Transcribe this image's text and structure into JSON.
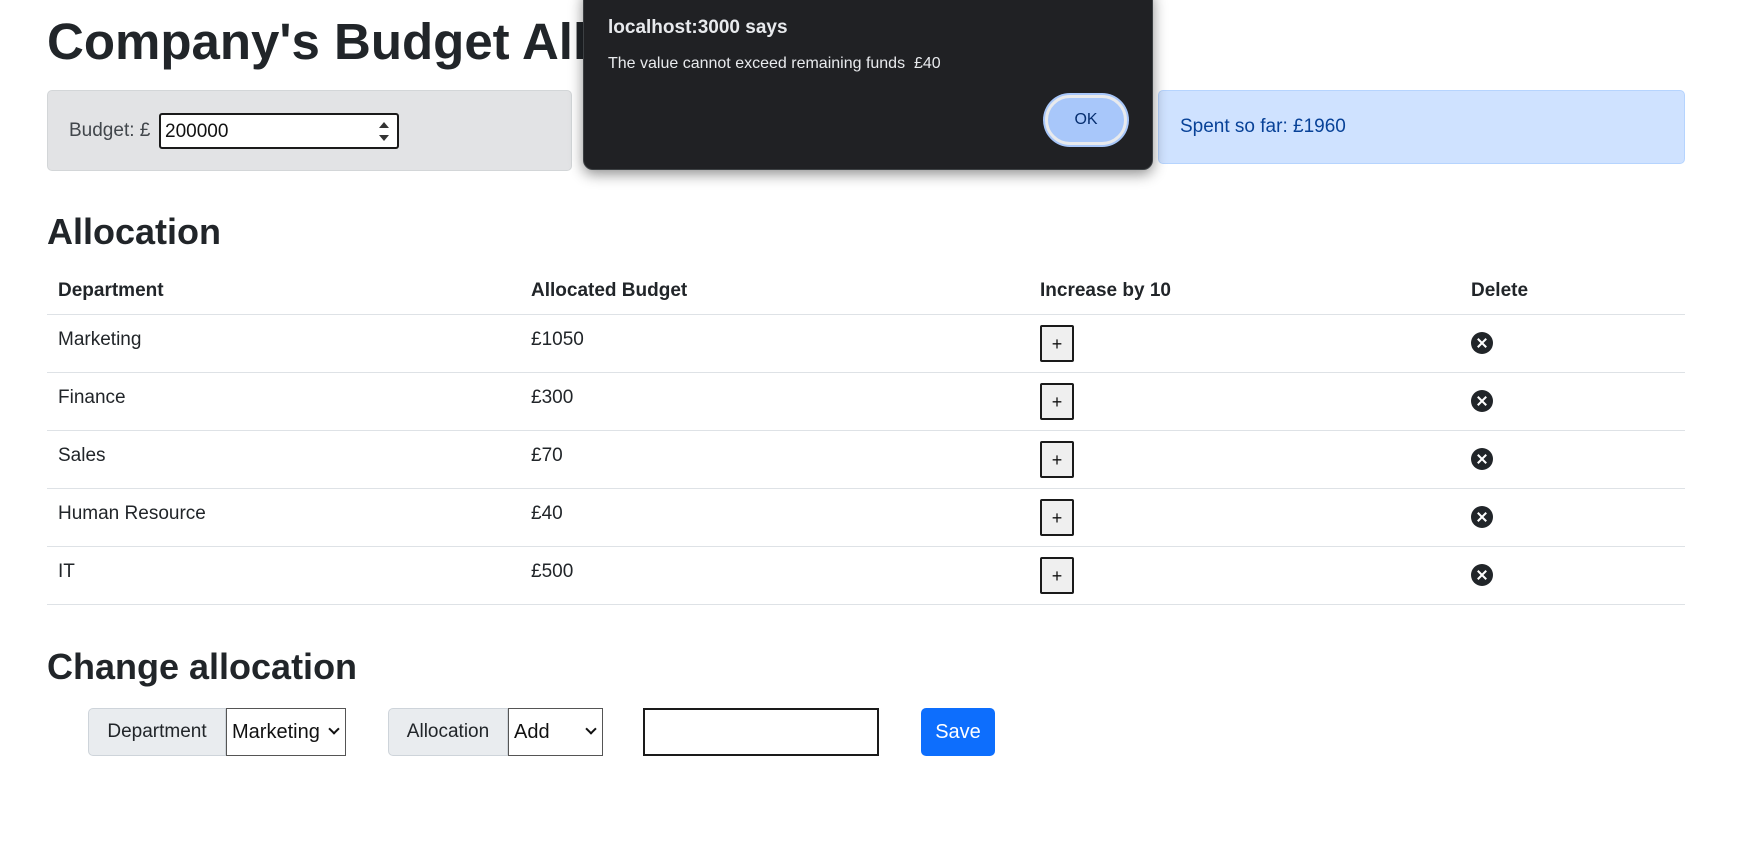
{
  "header": {
    "title": "Company's Budget Allo"
  },
  "budget": {
    "label": "Budget: £",
    "value": "200000"
  },
  "spent": {
    "text": "Spent so far: £1960"
  },
  "allocation": {
    "title": "Allocation",
    "columns": [
      "Department",
      "Allocated Budget",
      "Increase by 10",
      "Delete"
    ],
    "rows": [
      {
        "department": "Marketing",
        "budget": "£1050",
        "increase_label": "+"
      },
      {
        "department": "Finance",
        "budget": "£300",
        "increase_label": "+"
      },
      {
        "department": "Sales",
        "budget": "£70",
        "increase_label": "+"
      },
      {
        "department": "Human Resource",
        "budget": "£40",
        "increase_label": "+"
      },
      {
        "department": "IT",
        "budget": "£500",
        "increase_label": "+"
      }
    ],
    "delete_icon": "x-circle-icon"
  },
  "change": {
    "title": "Change allocation",
    "department_label": "Department",
    "department_selected": "Marketing",
    "allocation_label": "Allocation",
    "allocation_selected": "Add",
    "amount_value": "",
    "save_label": "Save"
  },
  "dialog": {
    "title": "localhost:3000 says",
    "message": "The value cannot exceed remaining funds  £40",
    "ok_label": "OK"
  },
  "colors": {
    "primary": "#0d6efd",
    "secondary_bg": "#e2e3e5",
    "info_bg": "#cfe2ff",
    "dialog_bg": "#202124",
    "dialog_button": "#a8c7fa"
  }
}
